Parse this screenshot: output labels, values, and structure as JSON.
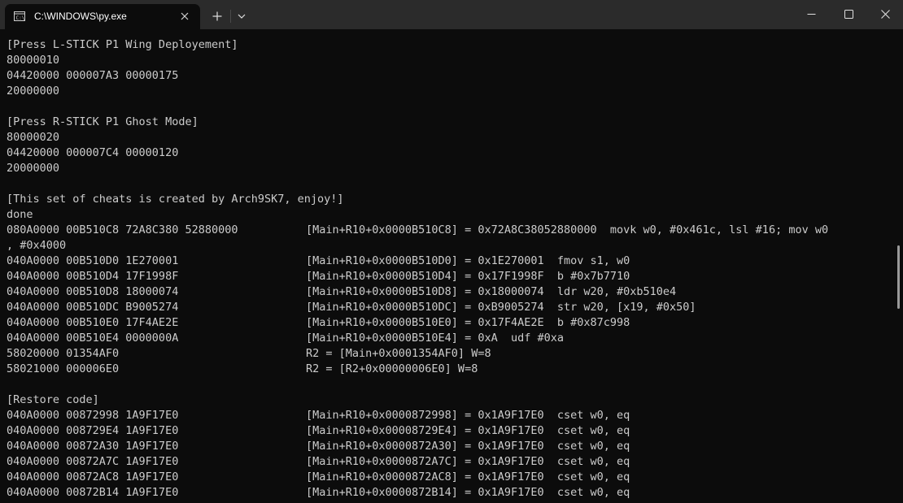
{
  "window": {
    "tab_title": "C:\\WINDOWS\\py.exe"
  },
  "icons": {
    "tab": "console-app-icon",
    "close_tab": "close-icon",
    "new_tab": "plus-icon",
    "dropdown": "chevron-down-icon",
    "minimize": "minimize-icon",
    "maximize": "maximize-icon",
    "close_window": "close-icon"
  },
  "colors": {
    "background": "#0c0c0c",
    "titlebar": "#2b2b2b",
    "text": "#cccccc"
  },
  "console": {
    "l01": "[Press L-STICK P1 Wing Deployement]",
    "l02": "80000010",
    "l03": "04420000 000007A3 00000175",
    "l04": "20000000",
    "l05": "[Press R-STICK P1 Ghost Mode]",
    "l06": "80000020",
    "l07": "04420000 000007C4 00000120",
    "l08": "20000000",
    "l09": "[This set of cheats is created by Arch9SK7, enjoy!]",
    "l10": "done",
    "l11a": "080A0000 00B510C8 72A8C380 52880000",
    "l11b": "[Main+R10+0x0000B510C8] = 0x72A8C38052880000  movk w0, #0x461c, lsl #16; mov w0",
    "l12": ", #0x4000",
    "r01a": "040A0000 00B510D0 1E270001",
    "r01b": "[Main+R10+0x0000B510D0] = 0x1E270001  fmov s1, w0",
    "r02a": "040A0000 00B510D4 17F1998F",
    "r02b": "[Main+R10+0x0000B510D4] = 0x17F1998F  b #0x7b7710",
    "r03a": "040A0000 00B510D8 18000074",
    "r03b": "[Main+R10+0x0000B510D8] = 0x18000074  ldr w20, #0xb510e4",
    "r04a": "040A0000 00B510DC B9005274",
    "r04b": "[Main+R10+0x0000B510DC] = 0xB9005274  str w20, [x19, #0x50]",
    "r05a": "040A0000 00B510E0 17F4AE2E",
    "r05b": "[Main+R10+0x0000B510E0] = 0x17F4AE2E  b #0x87c998",
    "r06a": "040A0000 00B510E4 0000000A",
    "r06b": "[Main+R10+0x0000B510E4] = 0xA  udf #0xa",
    "r07a": "58020000 01354AF0",
    "r07b": "R2 = [Main+0x0001354AF0] W=8",
    "r08a": "58021000 000006E0",
    "r08b": "R2 = [R2+0x00000006E0] W=8",
    "l13": "[Restore code]",
    "s01a": "040A0000 00872998 1A9F17E0",
    "s01b": "[Main+R10+0x0000872998] = 0x1A9F17E0  cset w0, eq",
    "s02a": "040A0000 008729E4 1A9F17E0",
    "s02b": "[Main+R10+0x00008729E4] = 0x1A9F17E0  cset w0, eq",
    "s03a": "040A0000 00872A30 1A9F17E0",
    "s03b": "[Main+R10+0x0000872A30] = 0x1A9F17E0  cset w0, eq",
    "s04a": "040A0000 00872A7C 1A9F17E0",
    "s04b": "[Main+R10+0x0000872A7C] = 0x1A9F17E0  cset w0, eq",
    "s05a": "040A0000 00872AC8 1A9F17E0",
    "s05b": "[Main+R10+0x0000872AC8] = 0x1A9F17E0  cset w0, eq",
    "s06a": "040A0000 00872B14 1A9F17E0",
    "s06b": "[Main+R10+0x0000872B14] = 0x1A9F17E0  cset w0, eq"
  }
}
